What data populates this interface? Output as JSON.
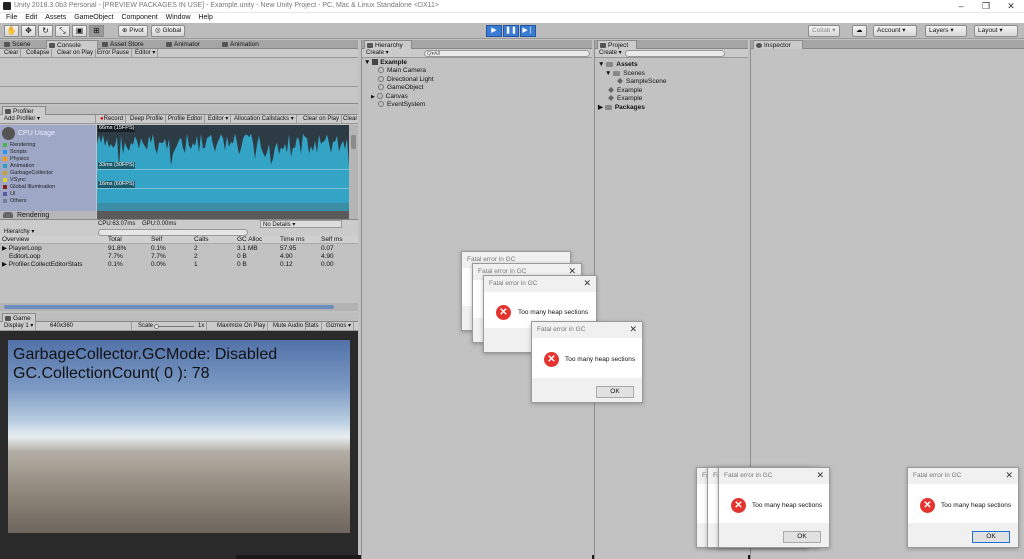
{
  "window": {
    "title": "Unity 2018.3.0b3 Personal - [PREVIEW PACKAGES IN USE] - Example.unity - New Unity Project - PC, Mac & Linux Standalone <DX11>",
    "minimize": "–",
    "maximize": "❐",
    "close": "✕"
  },
  "menu": [
    "File",
    "Edit",
    "Assets",
    "GameObject",
    "Component",
    "Window",
    "Help"
  ],
  "toolbar": {
    "pivot": "Pivot",
    "global": "Global",
    "collab": "Collab ▾",
    "account": "Account",
    "layers": "Layers",
    "layout": "Layout"
  },
  "tabs_top_left": {
    "scene": "Scene",
    "console": "Console",
    "asset_store": "Asset Store",
    "animator": "Animator",
    "animation": "Animation"
  },
  "console_toolbar": [
    "Clear",
    "Collapse",
    "Clear on Play",
    "Error Pause",
    "Editor ▾"
  ],
  "profiler": {
    "tab": "Profiler",
    "add_profiler": "Add Profiler",
    "toolbar": [
      "Record",
      "Deep Profile",
      "Profile Editor",
      "Editor ▾",
      "Allocation Callstacks ▾",
      "Clear on Play",
      "Clear"
    ],
    "cpu_title": "CPU Usage",
    "legend": [
      {
        "name": "Rendering",
        "color": "#4caf50"
      },
      {
        "name": "Scripts",
        "color": "#2196f3"
      },
      {
        "name": "Physics",
        "color": "#ff9800"
      },
      {
        "name": "Animation",
        "color": "#2e9ec0"
      },
      {
        "name": "GarbageCollector",
        "color": "#c9a42b"
      },
      {
        "name": "VSync",
        "color": "#e6d21e"
      },
      {
        "name": "Global Illumination",
        "color": "#8a1e1e"
      },
      {
        "name": "UI",
        "color": "#555aa0"
      },
      {
        "name": "Others",
        "color": "#7a7a9a"
      }
    ],
    "rendering_title": "Rendering",
    "graph_labels": [
      "66ms (15FPS)",
      "33ms (30FPS)",
      "16ms (60FPS)"
    ],
    "timings": {
      "cpu": "CPU:63.07ms",
      "gpu": "GPU:0.00ms"
    },
    "details": "No Details",
    "view_mode": "Hierarchy",
    "columns": [
      "Overview",
      "Total",
      "Self",
      "Calls",
      "GC Alloc",
      "Time ms",
      "Self ms"
    ],
    "rows": [
      [
        "▶ PlayerLoop",
        "91.8%",
        "0.1%",
        "2",
        "3.1 MB",
        "57.95",
        "0.07"
      ],
      [
        "EditorLoop",
        "7.7%",
        "7.7%",
        "2",
        "0 B",
        "4.90",
        "4.90"
      ],
      [
        "▶ Profiler.CollectEditorStats",
        "0.1%",
        "0.0%",
        "1",
        "0 B",
        "0.12",
        "0.00"
      ]
    ]
  },
  "game": {
    "tab": "Game",
    "display": "Display 1",
    "resolution": "640x360",
    "scale_label": "Scale",
    "scale_value": "1x",
    "toggles": [
      "Maximize On Play",
      "Mute Audio",
      "Stats",
      "Gizmos ▾"
    ],
    "overlay_lines": [
      "GarbageCollector.GCMode: Disabled",
      "GC.CollectionCount( 0 ): 78"
    ]
  },
  "hierarchy": {
    "tab": "Hierarchy",
    "create": "Create ▾",
    "search_placeholder": "Q▾All",
    "scene": "Example",
    "items": [
      "Main Camera",
      "Directional Light",
      "GameObject",
      "Canvas",
      "EventSystem"
    ]
  },
  "project": {
    "tab": "Project",
    "create": "Create ▾",
    "assets": "Assets",
    "scenes": "Scenes",
    "sample_scene": "SampleScene",
    "items": [
      "Example",
      "Example"
    ],
    "packages": "Packages"
  },
  "inspector": {
    "tab": "Inspector"
  },
  "dialog": {
    "title": "Fatal error in GC",
    "message": "Too many heap sections",
    "ok": "OK",
    "close": "✕"
  }
}
